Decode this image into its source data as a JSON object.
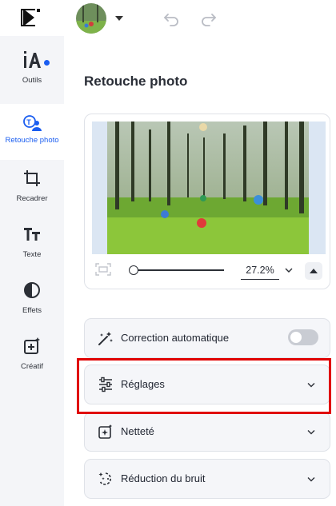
{
  "sidebar": {
    "items": [
      {
        "label": "Outils",
        "icon": "ai-icon"
      },
      {
        "label": "Retouche photo",
        "icon": "retouch-icon"
      },
      {
        "label": "Recadrer",
        "icon": "crop-icon"
      },
      {
        "label": "Texte",
        "icon": "text-icon"
      },
      {
        "label": "Effets",
        "icon": "effects-icon"
      },
      {
        "label": "Créatif",
        "icon": "creative-icon"
      }
    ]
  },
  "panel": {
    "title": "Retouche photo",
    "zoom": "27.2%",
    "features": [
      {
        "label": "Correction automatique",
        "icon": "magic-wand-icon"
      },
      {
        "label": "Réglages",
        "icon": "sliders-icon"
      },
      {
        "label": "Netteté",
        "icon": "sharpness-icon"
      },
      {
        "label": "Réduction du bruit",
        "icon": "denoise-icon"
      }
    ]
  },
  "colors": {
    "accent": "#1a5df0",
    "highlight": "#e00000"
  }
}
